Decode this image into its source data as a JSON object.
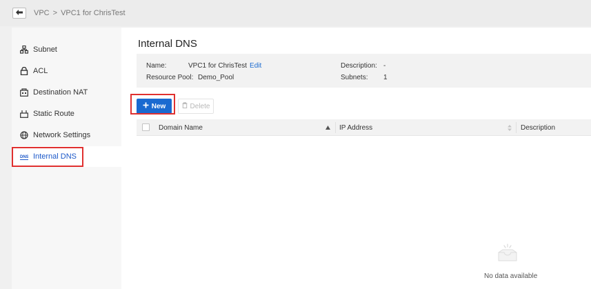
{
  "breadcrumb": {
    "root": "VPC",
    "separator": ">",
    "current": "VPC1 for ChrisTest"
  },
  "sidebar": {
    "items": [
      {
        "label": "Subnet",
        "icon": "subnet-icon"
      },
      {
        "label": "ACL",
        "icon": "lock-icon"
      },
      {
        "label": "Destination NAT",
        "icon": "nat-icon"
      },
      {
        "label": "Static Route",
        "icon": "route-icon"
      },
      {
        "label": "Network Settings",
        "icon": "globe-icon"
      },
      {
        "label": "Internal DNS",
        "icon": "dns-icon",
        "active": true
      }
    ]
  },
  "page": {
    "title": "Internal DNS"
  },
  "info": {
    "name_label": "Name:",
    "name_value": "VPC1 for ChrisTest",
    "edit_label": "Edit",
    "resource_pool_label": "Resource Pool:",
    "resource_pool_value": "Demo_Pool",
    "description_label": "Description:",
    "description_value": "-",
    "subnets_label": "Subnets:",
    "subnets_value": "1"
  },
  "toolbar": {
    "new_label": "New",
    "delete_label": "Delete"
  },
  "table": {
    "columns": [
      "Domain Name",
      "IP Address",
      "Description"
    ],
    "empty_text": "No data available"
  },
  "colors": {
    "accent": "#1a6ad0",
    "highlight": "#e0302f",
    "active_text": "#1a57c8"
  }
}
